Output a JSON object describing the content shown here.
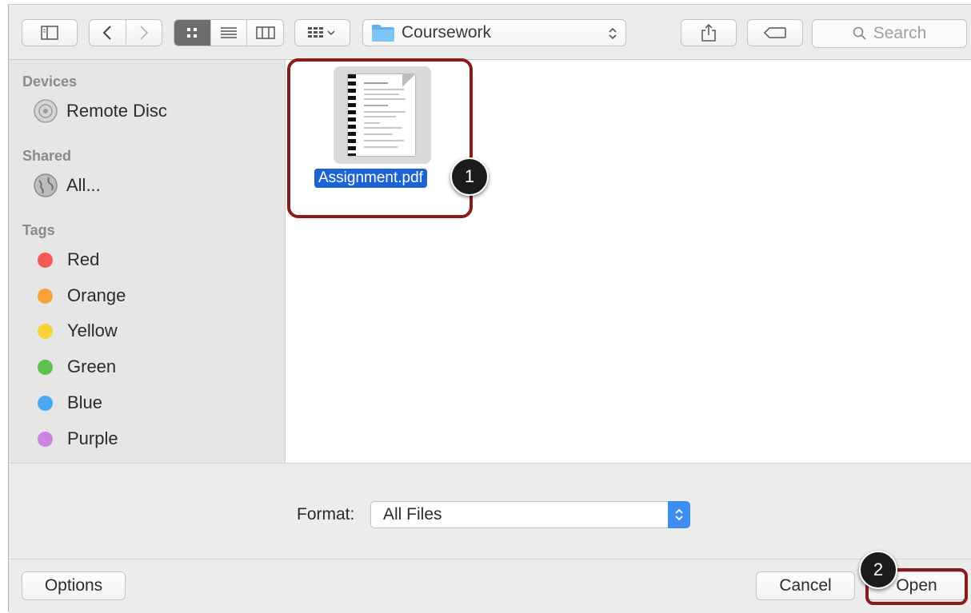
{
  "toolbar": {
    "path_label": "Coursework",
    "search_placeholder": "Search",
    "icons": [
      "sidebar-toggle-icon",
      "back-icon",
      "forward-icon",
      "icon-view-icon",
      "list-view-icon",
      "column-view-icon",
      "arrange-icon",
      "folder-icon",
      "share-icon",
      "tag-icon",
      "search-icon"
    ]
  },
  "sidebar": {
    "devices_heading": "Devices",
    "devices": [
      {
        "label": "Remote Disc",
        "icon": "disc-icon"
      }
    ],
    "shared_heading": "Shared",
    "shared": [
      {
        "label": "All...",
        "icon": "network-icon"
      }
    ],
    "tags_heading": "Tags",
    "tags": [
      {
        "label": "Red",
        "color": "#f25a55"
      },
      {
        "label": "Orange",
        "color": "#f7a33a"
      },
      {
        "label": "Yellow",
        "color": "#f7d23a"
      },
      {
        "label": "Green",
        "color": "#5ec14e"
      },
      {
        "label": "Blue",
        "color": "#4aa7f0"
      },
      {
        "label": "Purple",
        "color": "#cc84e0"
      }
    ]
  },
  "files": [
    {
      "name": "Assignment.pdf",
      "selected": true,
      "icon": "pdf-document-icon"
    }
  ],
  "callouts": {
    "one": "1",
    "two": "2"
  },
  "format": {
    "label": "Format:",
    "value": "All Files"
  },
  "buttons": {
    "options": "Options",
    "cancel": "Cancel",
    "open": "Open"
  },
  "colors": {
    "selection": "#1c63d4",
    "highlight": "#8b1a1a",
    "accent": "#3d8ef0"
  }
}
